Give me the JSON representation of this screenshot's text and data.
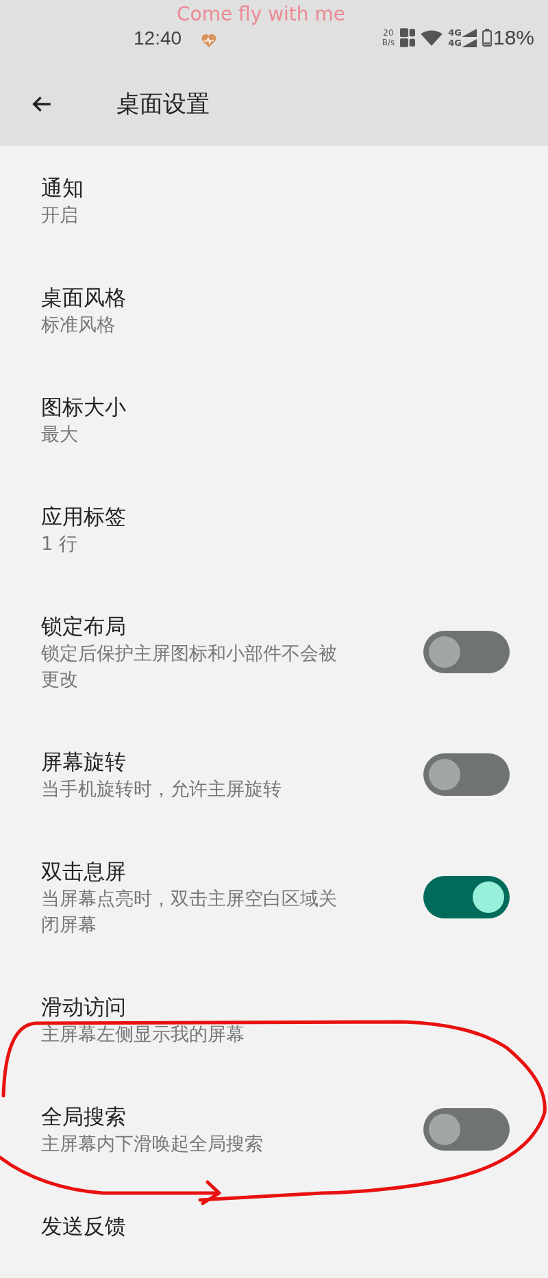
{
  "status_bar": {
    "time": "12:40",
    "caption": "Come fly with me",
    "net_speed": "20",
    "net_unit": "B/s",
    "networks": [
      "4G",
      "4G"
    ],
    "battery": "18%"
  },
  "app_bar": {
    "title": "桌面设置"
  },
  "settings": [
    {
      "kind": "nav",
      "title": "通知",
      "subtitle": "开启"
    },
    {
      "kind": "nav",
      "title": "桌面风格",
      "subtitle": "标准风格"
    },
    {
      "kind": "nav",
      "title": "图标大小",
      "subtitle": "最大"
    },
    {
      "kind": "nav",
      "title": "应用标签",
      "subtitle": "1 行"
    },
    {
      "kind": "switch",
      "title": "锁定布局",
      "subtitle": "锁定后保护主屏图标和小部件不会被更改",
      "on": false
    },
    {
      "kind": "switch",
      "title": "屏幕旋转",
      "subtitle": "当手机旋转时，允许主屏旋转",
      "on": false
    },
    {
      "kind": "switch",
      "title": "双击息屏",
      "subtitle": "当屏幕点亮时，双击主屏空白区域关闭屏幕",
      "on": true
    },
    {
      "kind": "nav",
      "title": "滑动访问",
      "subtitle": "主屏幕左侧显示我的屏幕"
    },
    {
      "kind": "switch",
      "title": "全局搜索",
      "subtitle": "主屏幕内下滑唤起全局搜索",
      "on": false
    },
    {
      "kind": "nav",
      "title": "发送反馈"
    }
  ]
}
